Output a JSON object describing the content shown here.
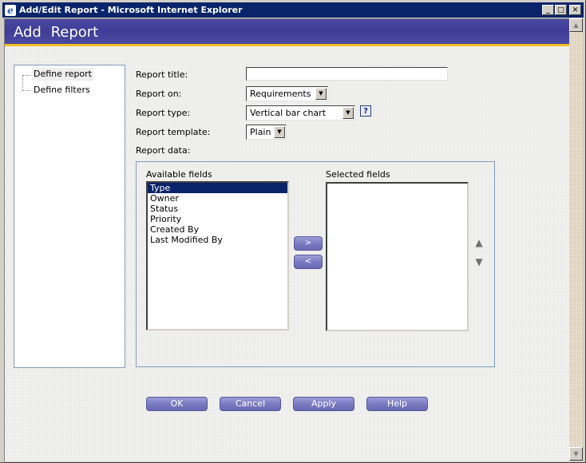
{
  "window": {
    "title": "Add/Edit Report - Microsoft Internet Explorer",
    "icon": "ie-icon",
    "controls": {
      "minimize": "_",
      "maximize": "□",
      "close": "✕"
    }
  },
  "header": {
    "title": "Add  Report"
  },
  "nav": {
    "items": [
      {
        "label": "Define report",
        "selected": true
      },
      {
        "label": "Define filters",
        "selected": false
      }
    ]
  },
  "form": {
    "report_title": {
      "label": "Report title:",
      "value": ""
    },
    "report_on": {
      "label": "Report on:",
      "value": "Requirements"
    },
    "report_type": {
      "label": "Report type:",
      "value": "Vertical bar chart",
      "help_icon": "?"
    },
    "report_template": {
      "label": "Report template:",
      "value": "Plain"
    },
    "report_data": {
      "label": "Report data:"
    }
  },
  "fields": {
    "available_label": "Available fields",
    "selected_label": "Selected fields",
    "available": [
      "Type",
      "Owner",
      "Status",
      "Priority",
      "Created By",
      "Last Modified By"
    ],
    "available_selected_index": 0,
    "selected": [],
    "add_button": ">",
    "remove_button": "<",
    "move_up_icon": "▲",
    "move_down_icon": "▼"
  },
  "actions": {
    "ok": "OK",
    "cancel": "Cancel",
    "apply": "Apply",
    "help": "Help"
  },
  "scrollbar": {
    "up": "▲",
    "down": "▼"
  },
  "colors": {
    "titlebar": "#0a246a",
    "header": "#3f3d96",
    "header_accent": "#f0c020",
    "button": "#7878c0",
    "panel_border": "#7f9db9"
  }
}
